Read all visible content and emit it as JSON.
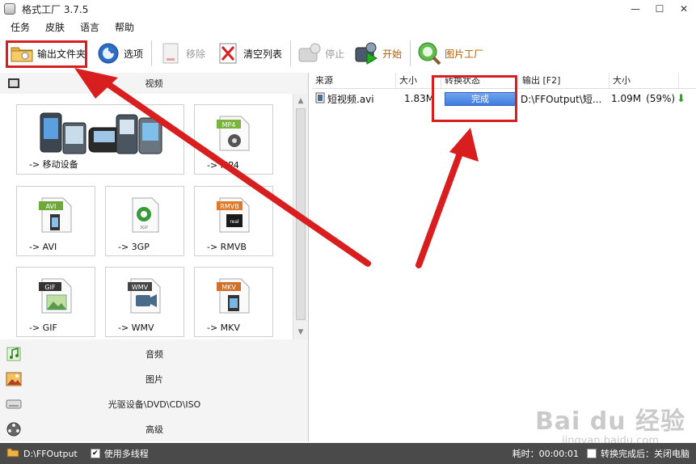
{
  "window": {
    "title": "格式工厂 3.7.5",
    "minimize": "—",
    "maximize": "☐",
    "close": "✕"
  },
  "menu": {
    "items": [
      "任务",
      "皮肤",
      "语言",
      "帮助"
    ]
  },
  "toolbar": {
    "output_folder": "输出文件夹",
    "options": "选项",
    "remove": "移除",
    "clear_list": "清空列表",
    "stop": "停止",
    "start": "开始",
    "picture_factory": "图片工厂"
  },
  "left": {
    "video_header": "视频",
    "tiles": {
      "mobile": "-> 移动设备",
      "mp4": "-> MP4",
      "avi": "-> AVI",
      "threegp": "-> 3GP",
      "rmvb": "-> RMVB",
      "gif": "-> GIF",
      "wmv": "-> WMV",
      "mkv": "-> MKV"
    },
    "badges": {
      "mp4": "MP4",
      "avi": "AVI",
      "threegp": "3GP",
      "rmvb": "RMVB",
      "gif": "GIF",
      "wmv": "WMV",
      "mkv": "MKV"
    },
    "categories": {
      "audio": "音频",
      "image": "图片",
      "disc": "光驱设备\\DVD\\CD\\ISO",
      "advanced": "高级"
    }
  },
  "table": {
    "headers": {
      "source": "来源",
      "size": "大小",
      "status": "转换状态",
      "output": "输出 [F2]",
      "out_size": "大小"
    },
    "row": {
      "source": "短视频.avi",
      "size": "1.83M",
      "status": "完成",
      "output": "D:\\FFOutput\\短...",
      "out_size": "1.09M",
      "ratio": "(59%)"
    }
  },
  "statusbar": {
    "output_path": "D:\\FFOutput",
    "multithread": "使用多线程",
    "elapsed": "耗时：00:00:01",
    "after_done": "转换完成后：关闭电脑"
  },
  "watermark": {
    "brand": "Bai du 经验",
    "url": "jingyan.baidu.com"
  },
  "colors": {
    "accent": "#d81e1e",
    "status_blue": "#3f7de0",
    "statusbar": "#4a4a4a"
  }
}
